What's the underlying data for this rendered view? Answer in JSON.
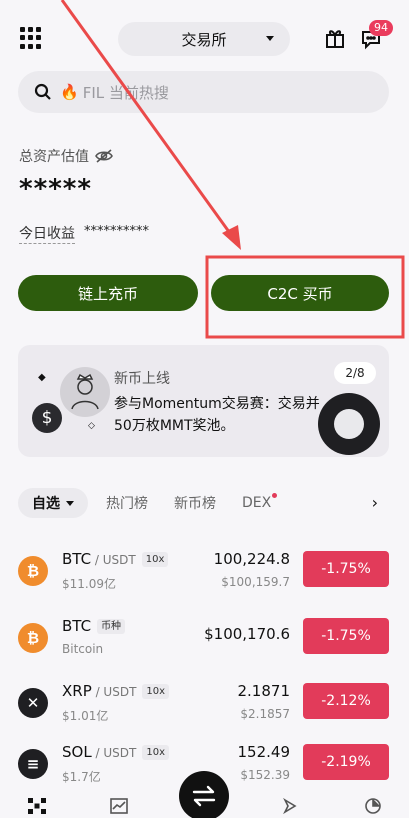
{
  "header": {
    "exchange_label": "交易所",
    "message_badge": "94"
  },
  "search": {
    "placeholder": "FIL 当前热搜"
  },
  "assets": {
    "label": "总资产估值",
    "value": "*****",
    "today_label": "今日收益",
    "today_value": "**********"
  },
  "actions": {
    "deposit_label": "链上充币",
    "c2c_label": "C2C 买币"
  },
  "news": {
    "title": "新币上线",
    "count": "2/8",
    "text_line1": "参与Momentum交易赛：交易并",
    "text_line2": "50万枚MMT奖池。",
    "dollar_symbol": "$"
  },
  "tabs": {
    "active": "自选",
    "items": [
      "热门榜",
      "新币榜",
      "DEX"
    ],
    "more_arrow": "›"
  },
  "market": [
    {
      "symbol": "BTC",
      "quote": " / USDT",
      "tag": "10x",
      "sub": "$11.09亿",
      "price": "100,224.8",
      "price_usd": "$100,159.7",
      "change": "-1.75%",
      "coin_color": "#f08c2d",
      "coin_glyph": "₿"
    },
    {
      "symbol": "BTC",
      "quote": "",
      "tag": "币种",
      "sub": "Bitcoin",
      "price": "$100,170.6",
      "price_usd": "",
      "change": "-1.75%",
      "coin_color": "#f08c2d",
      "coin_glyph": "₿"
    },
    {
      "symbol": "XRP",
      "quote": " / USDT",
      "tag": "10x",
      "sub": "$1.01亿",
      "price": "2.1871",
      "price_usd": "$2.1857",
      "change": "-2.12%",
      "coin_color": "#1f1f22",
      "coin_glyph": "✕"
    },
    {
      "symbol": "SOL",
      "quote": " / USDT",
      "tag": "10x",
      "sub": "$1.7亿",
      "price": "152.49",
      "price_usd": "$152.39",
      "change": "-2.19%",
      "coin_color": "#1f1f22",
      "coin_glyph": "≡"
    }
  ],
  "colors": {
    "button_green": "#2d5c0d",
    "down_red": "#e23b5a",
    "annotation_red": "#ea4a4a"
  }
}
